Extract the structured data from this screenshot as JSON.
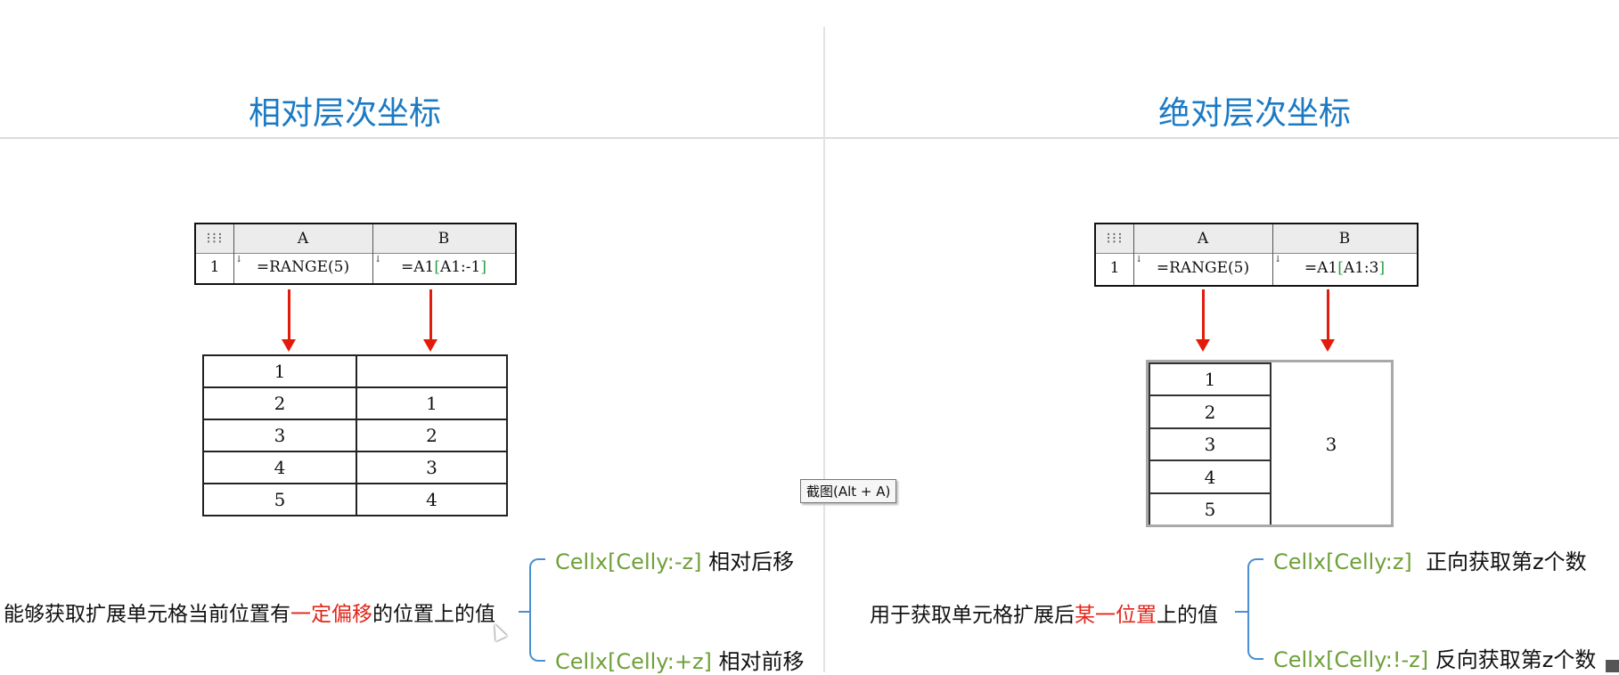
{
  "left": {
    "title": "相对层次坐标",
    "sheet": {
      "col_a": "A",
      "col_b": "B",
      "row": "1",
      "formula_a": "=RANGE(5)",
      "formula_b_prefix": "=A1",
      "formula_b_ref": "A1:-1"
    },
    "result_rows": [
      [
        "1",
        ""
      ],
      [
        "2",
        "1"
      ],
      [
        "3",
        "2"
      ],
      [
        "4",
        "3"
      ],
      [
        "5",
        "4"
      ]
    ],
    "desc_before": "能够获取扩展单元格当前位置有",
    "desc_highlight": "一定偏移",
    "desc_after": "的位置上的值",
    "branches": [
      {
        "code": "Cellx[Celly:-z]",
        "text": "相对后移"
      },
      {
        "code": "Cellx[Celly:+z]",
        "text": "相对前移"
      }
    ]
  },
  "right": {
    "title": "绝对层次坐标",
    "sheet": {
      "col_a": "A",
      "col_b": "B",
      "row": "1",
      "formula_a": "=RANGE(5)",
      "formula_b_prefix": "=A1",
      "formula_b_ref": "A1:3"
    },
    "result_col_a": [
      "1",
      "2",
      "3",
      "4",
      "5"
    ],
    "result_merged": "3",
    "desc_before": "用于获取单元格扩展后",
    "desc_highlight": "某一位置",
    "desc_after": "上的值",
    "branches": [
      {
        "code": "Cellx[Celly:z]",
        "text": "正向获取第z个数"
      },
      {
        "code": "Cellx[Celly:!-z]",
        "text": "反向获取第z个数"
      }
    ]
  },
  "tooltip": "截图(Alt + A)",
  "colors": {
    "title": "#1b7ac4",
    "highlight": "#e0261a",
    "code": "#6fa039",
    "arrow": "#e21b0c"
  }
}
